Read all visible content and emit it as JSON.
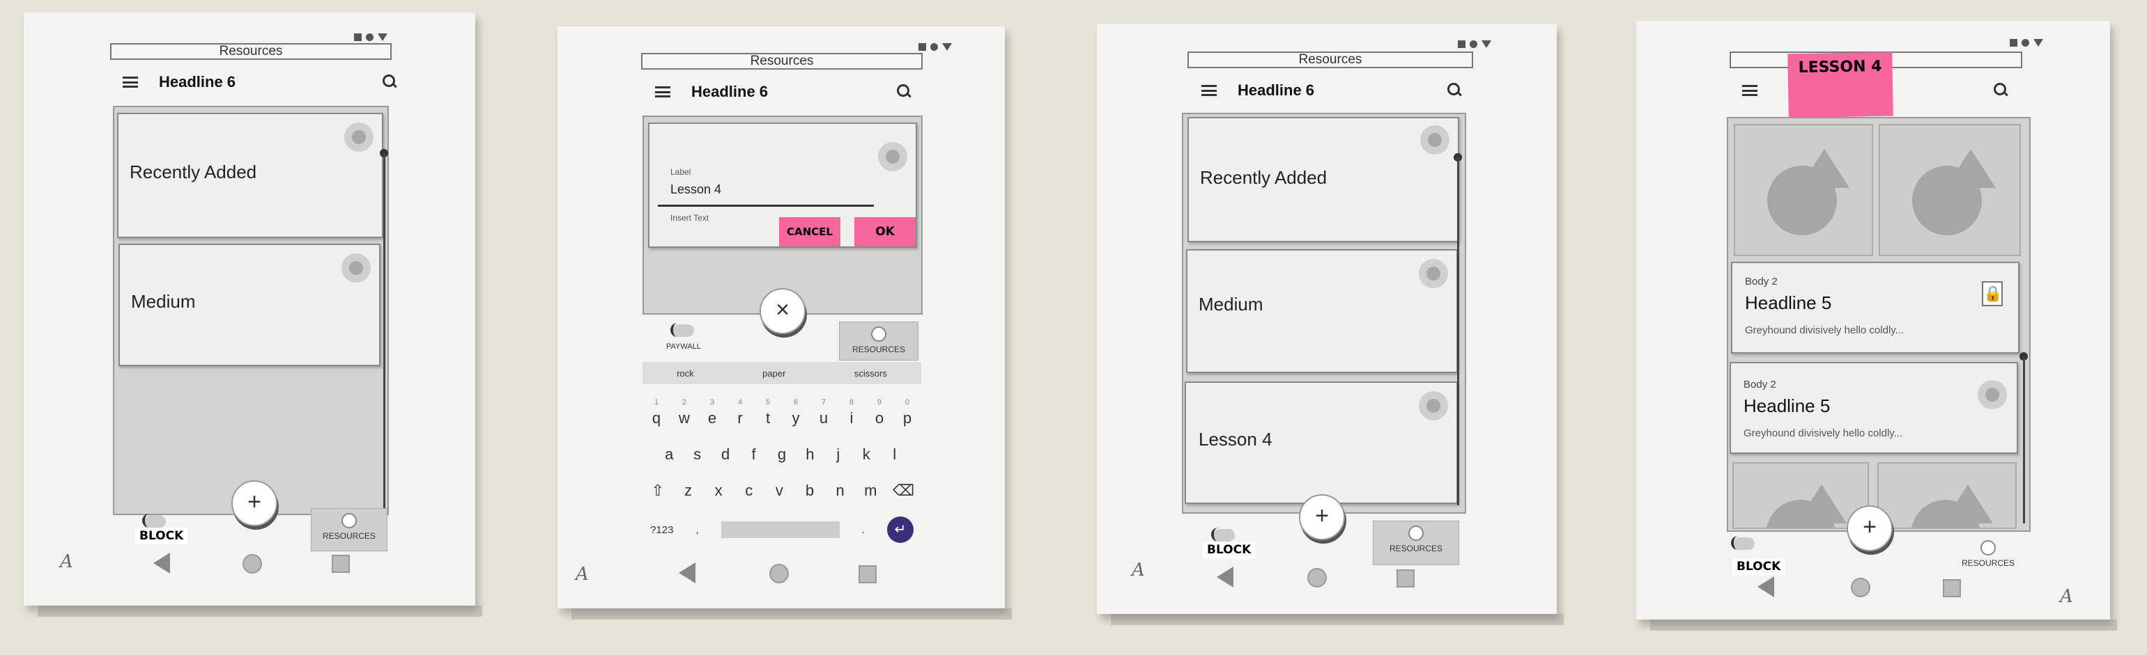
{
  "resources_label": "Resources",
  "headline": "Headline 6",
  "screen1": {
    "cards": [
      "Recently Added",
      "Medium"
    ],
    "fab": "+",
    "toggle_label": "BLOCK",
    "resources_button": "RESOURCES"
  },
  "screen2": {
    "field_label": "Label",
    "field_value": "Lesson 4",
    "helper": "Insert Text",
    "cancel": "CANCEL",
    "ok": "OK",
    "close_fab": "×",
    "paywall": "PAYWALL",
    "resources_button": "RESOURCES",
    "suggestions": [
      "rock",
      "paper",
      "scissors"
    ],
    "numbers": [
      "1",
      "2",
      "3",
      "4",
      "5",
      "6",
      "7",
      "8",
      "9",
      "0"
    ],
    "row1": [
      "q",
      "w",
      "e",
      "r",
      "t",
      "y",
      "u",
      "i",
      "o",
      "p"
    ],
    "row2": [
      "a",
      "s",
      "d",
      "f",
      "g",
      "h",
      "j",
      "k",
      "l"
    ],
    "row3": [
      "z",
      "x",
      "c",
      "v",
      "b",
      "n",
      "m"
    ],
    "shift": "⇧",
    "backspace": "⌫",
    "symbols": "?123",
    "comma": ",",
    "period": ".",
    "enter": "↵"
  },
  "screen3": {
    "cards": [
      "Recently Added",
      "Medium",
      "Lesson 4"
    ],
    "fab": "+",
    "toggle_label": "BLOCK",
    "resources_button": "RESOURCES"
  },
  "screen4": {
    "sticky": "LESSON 4",
    "cards": [
      {
        "overline": "Body 2",
        "title": "Headline 5",
        "body": "Greyhound divisively hello coldly..."
      },
      {
        "overline": "Body 2",
        "title": "Headline 5",
        "body": "Greyhound divisively hello coldly..."
      }
    ],
    "fab": "+",
    "toggle_label": "BLOCK",
    "resources_button": "RESOURCES"
  },
  "signature": "A"
}
